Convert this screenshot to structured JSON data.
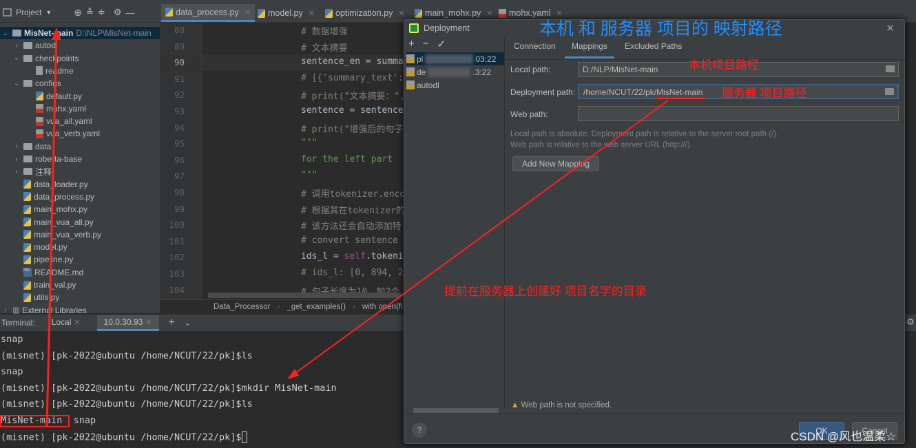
{
  "project_header": {
    "label": "Project"
  },
  "tabs": [
    "data_process.py",
    "model.py",
    "optimization.py",
    "main_mohx.py",
    "mohx.yaml"
  ],
  "tree": [
    {
      "label": "MisNet-main",
      "path": "D:\\NLP\\MisNet-main",
      "type": "root",
      "depth": 0,
      "expanded": true
    },
    {
      "label": "autodl",
      "type": "folder",
      "depth": 1,
      "expanded": false
    },
    {
      "label": "checkpoints",
      "type": "folder",
      "depth": 1,
      "expanded": true
    },
    {
      "label": "readme",
      "type": "file",
      "depth": 2
    },
    {
      "label": "configs",
      "type": "folder",
      "depth": 1,
      "expanded": true
    },
    {
      "label": "default.py",
      "type": "py",
      "depth": 2
    },
    {
      "label": "mohx.yaml",
      "type": "yaml",
      "depth": 2
    },
    {
      "label": "vua_all.yaml",
      "type": "yaml",
      "depth": 2
    },
    {
      "label": "vua_verb.yaml",
      "type": "yaml",
      "depth": 2
    },
    {
      "label": "data",
      "type": "folder",
      "depth": 1,
      "expanded": false
    },
    {
      "label": "roberta-base",
      "type": "folder",
      "depth": 1,
      "expanded": false
    },
    {
      "label": "注释",
      "type": "folder",
      "depth": 1,
      "expanded": false
    },
    {
      "label": "data_loader.py",
      "type": "py",
      "depth": 1
    },
    {
      "label": "data_process.py",
      "type": "py",
      "depth": 1
    },
    {
      "label": "main_mohx.py",
      "type": "py",
      "depth": 1
    },
    {
      "label": "main_vua_all.py",
      "type": "py",
      "depth": 1
    },
    {
      "label": "main_vua_verb.py",
      "type": "py",
      "depth": 1
    },
    {
      "label": "model.py",
      "type": "py",
      "depth": 1
    },
    {
      "label": "pipeline.py",
      "type": "py",
      "depth": 1
    },
    {
      "label": "README.md",
      "type": "md",
      "depth": 1
    },
    {
      "label": "train_val.py",
      "type": "py",
      "depth": 1
    },
    {
      "label": "utils.py",
      "type": "py",
      "depth": 1
    },
    {
      "label": "External Libraries",
      "type": "lib",
      "depth": 0,
      "expanded": false
    }
  ],
  "editor": {
    "current_line": 90,
    "lines": [
      {
        "n": "88",
        "text": "# 数据增强",
        "k": "cm"
      },
      {
        "n": "89",
        "text": "# 文本摘要",
        "k": "cm"
      },
      {
        "n": "90",
        "text": "sentence_en = summa",
        "k": ""
      },
      {
        "n": "91",
        "text": "# [{'summary_text':",
        "k": "cm"
      },
      {
        "n": "92",
        "text": "# print(\"文本摘要：\",",
        "k": "cm"
      },
      {
        "n": "93",
        "text": "sentence = sentence",
        "k": ""
      },
      {
        "n": "94",
        "text": "# print(\"增强后的句子",
        "k": "cm"
      },
      {
        "n": "95",
        "text": "\"\"\"",
        "k": "str"
      },
      {
        "n": "96",
        "text": "for the left part",
        "k": "str"
      },
      {
        "n": "97",
        "text": "\"\"\"",
        "k": "str"
      },
      {
        "n": "98",
        "text": "# 调用tokenizer.enco",
        "k": "cm"
      },
      {
        "n": "99",
        "text": "# 根据其在tokenizer的",
        "k": "cm"
      },
      {
        "n": "100",
        "text": "# 该方法还会自动添加特",
        "k": "cm"
      },
      {
        "n": "101",
        "text": "# convert sentence",
        "k": "cm"
      },
      {
        "n": "102",
        "text": "ids_l = self.tokeni",
        "k": "self"
      },
      {
        "n": "103",
        "text": "# ids_l: [0, 894, 2",
        "k": "cm"
      },
      {
        "n": "104",
        "text": "# 句子长度为10，加2个",
        "k": "cm"
      }
    ],
    "breadcrumb": [
      "Data_Processor",
      "_get_examples()",
      "with open(fi"
    ]
  },
  "terminal": {
    "label": "Terminal:",
    "tabs": [
      "Local",
      "10.0.30.93"
    ],
    "active_tab": "10.0.30.93",
    "lines": [
      "snap",
      "(misnet) [pk-2022@ubuntu /home/NCUT/22/pk]$ls",
      "snap",
      "(misnet) [pk-2022@ubuntu /home/NCUT/22/pk]$mkdir MisNet-main",
      "(misnet) [pk-2022@ubuntu /home/NCUT/22/pk]$ls",
      "MisNet-main  snap",
      "(misnet) [pk-2022@ubuntu /home/NCUT/22/pk]$"
    ]
  },
  "dialog": {
    "title": "Deployment",
    "servers": [
      {
        "label": "pl",
        "suffix": "03:22",
        "selected": true
      },
      {
        "label": "de",
        "suffix": ".3:22"
      },
      {
        "label": "autodl"
      }
    ],
    "tabs": [
      "Connection",
      "Mappings",
      "Excluded Paths"
    ],
    "active_tab": "Mappings",
    "local_path_label": "Local path:",
    "local_path": "D:/NLP/MisNet-main",
    "deployment_path_label": "Deployment path:",
    "deployment_path": "/home/NCUT/22/pk/MisNet-main",
    "web_path_label": "Web path:",
    "web_path": "",
    "hint1": "Local path is absolute. Deployment path is relative to the server root path (/).",
    "hint2": "Web path is relative to the web server URL (http:///).",
    "add_mapping": "Add New Mapping",
    "warning": "Web path is not specified.",
    "ok": "OK",
    "cancel": "Cancel",
    "help": "?"
  },
  "annotations": {
    "title": "本机 和 服务器 项目的 映射路径",
    "local": "本机项目路径",
    "server": "服务器 项目路径",
    "mkdir": "提前在服务器上创建好 项目名字的目录",
    "color": "#ff2020",
    "title_color": "#1e90ff"
  },
  "watermark": "CSDN @风也温柔☆"
}
